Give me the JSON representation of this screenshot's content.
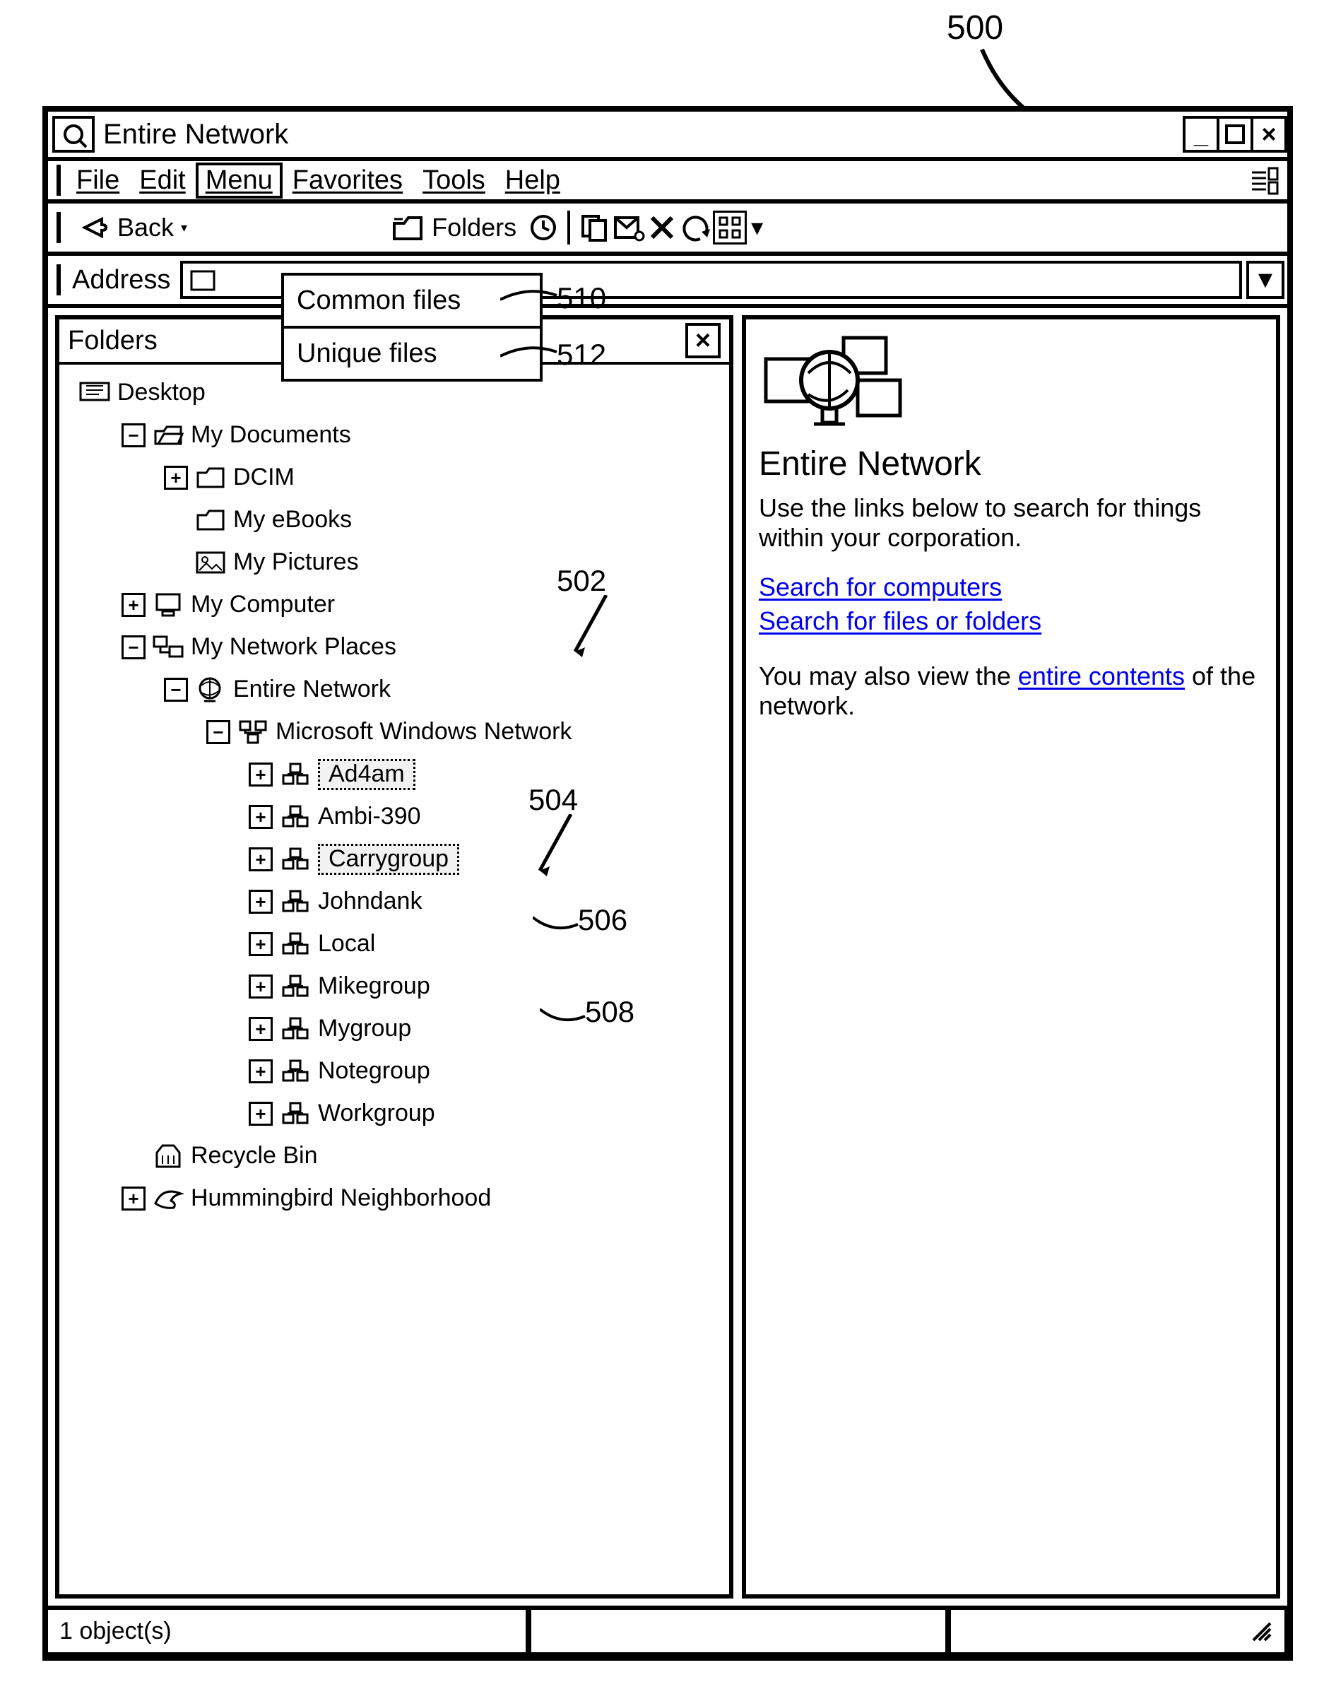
{
  "figure_label": "500",
  "window": {
    "title": "Entire Network",
    "controls": {
      "minimize": "–",
      "maximize": "",
      "close": "×"
    }
  },
  "menubar": {
    "items": [
      {
        "label": "File",
        "accel": "F"
      },
      {
        "label": "Edit",
        "accel": "E"
      },
      {
        "label": "Menu",
        "accel": "M",
        "selected": true
      },
      {
        "label": "Favorites",
        "accel": "a"
      },
      {
        "label": "Tools",
        "accel": "T"
      },
      {
        "label": "Help",
        "accel": "H"
      }
    ]
  },
  "menu_dropdown": {
    "items": [
      {
        "label": "Common files",
        "callout": "510"
      },
      {
        "label": "Unique files",
        "callout": "512"
      }
    ]
  },
  "toolbar": {
    "back": "Back",
    "folders": "Folders"
  },
  "addressbar": {
    "label": "Address"
  },
  "folders_pane": {
    "header": "Folders"
  },
  "tree": {
    "root": "Desktop",
    "nodes": [
      {
        "level": 0,
        "icon": "desktop",
        "label": "Desktop",
        "expander": null
      },
      {
        "level": 1,
        "icon": "folder-open",
        "label": "My Documents",
        "expander": "minus"
      },
      {
        "level": 2,
        "icon": "folder",
        "label": "DCIM",
        "expander": "plus"
      },
      {
        "level": 2,
        "icon": "folder",
        "label": "My eBooks",
        "expander": "none"
      },
      {
        "level": 2,
        "icon": "picture",
        "label": "My Pictures",
        "expander": "none"
      },
      {
        "level": 1,
        "icon": "computer",
        "label": "My Computer",
        "expander": "plus"
      },
      {
        "level": 1,
        "icon": "network-places",
        "label": "My Network Places",
        "expander": "minus"
      },
      {
        "level": 2,
        "icon": "globe",
        "label": "Entire Network",
        "expander": "minus"
      },
      {
        "level": 3,
        "icon": "network",
        "label": "Microsoft Windows Network",
        "expander": "minus"
      },
      {
        "level": 4,
        "icon": "workgroup",
        "label": "Ad4am",
        "expander": "plus",
        "highlight": true,
        "callout": "506"
      },
      {
        "level": 4,
        "icon": "workgroup",
        "label": "Ambi-390",
        "expander": "plus"
      },
      {
        "level": 4,
        "icon": "workgroup",
        "label": "Carrygroup",
        "expander": "plus",
        "highlight": true,
        "callout": "508"
      },
      {
        "level": 4,
        "icon": "workgroup",
        "label": "Johndank",
        "expander": "plus"
      },
      {
        "level": 4,
        "icon": "workgroup",
        "label": "Local",
        "expander": "plus"
      },
      {
        "level": 4,
        "icon": "workgroup",
        "label": "Mikegroup",
        "expander": "plus"
      },
      {
        "level": 4,
        "icon": "workgroup",
        "label": "Mygroup",
        "expander": "plus"
      },
      {
        "level": 4,
        "icon": "workgroup",
        "label": "Notegroup",
        "expander": "plus"
      },
      {
        "level": 4,
        "icon": "workgroup",
        "label": "Workgroup",
        "expander": "plus"
      },
      {
        "level": 1,
        "icon": "recycle",
        "label": "Recycle Bin",
        "expander": "none"
      },
      {
        "level": 1,
        "icon": "humming",
        "label": "Hummingbird Neighborhood",
        "expander": "plus"
      }
    ],
    "pane_callouts": {
      "area_502": "502",
      "entire_network_504": "504"
    }
  },
  "right_pane": {
    "title": "Entire Network",
    "lead": "Use the links below to search for things within your corporation.",
    "link1": "Search for computers",
    "link2": "Search for files or folders",
    "tail_pre": "You may also view the ",
    "tail_link": "entire contents",
    "tail_post": " of the network."
  },
  "statusbar": {
    "text": "1 object(s)"
  }
}
